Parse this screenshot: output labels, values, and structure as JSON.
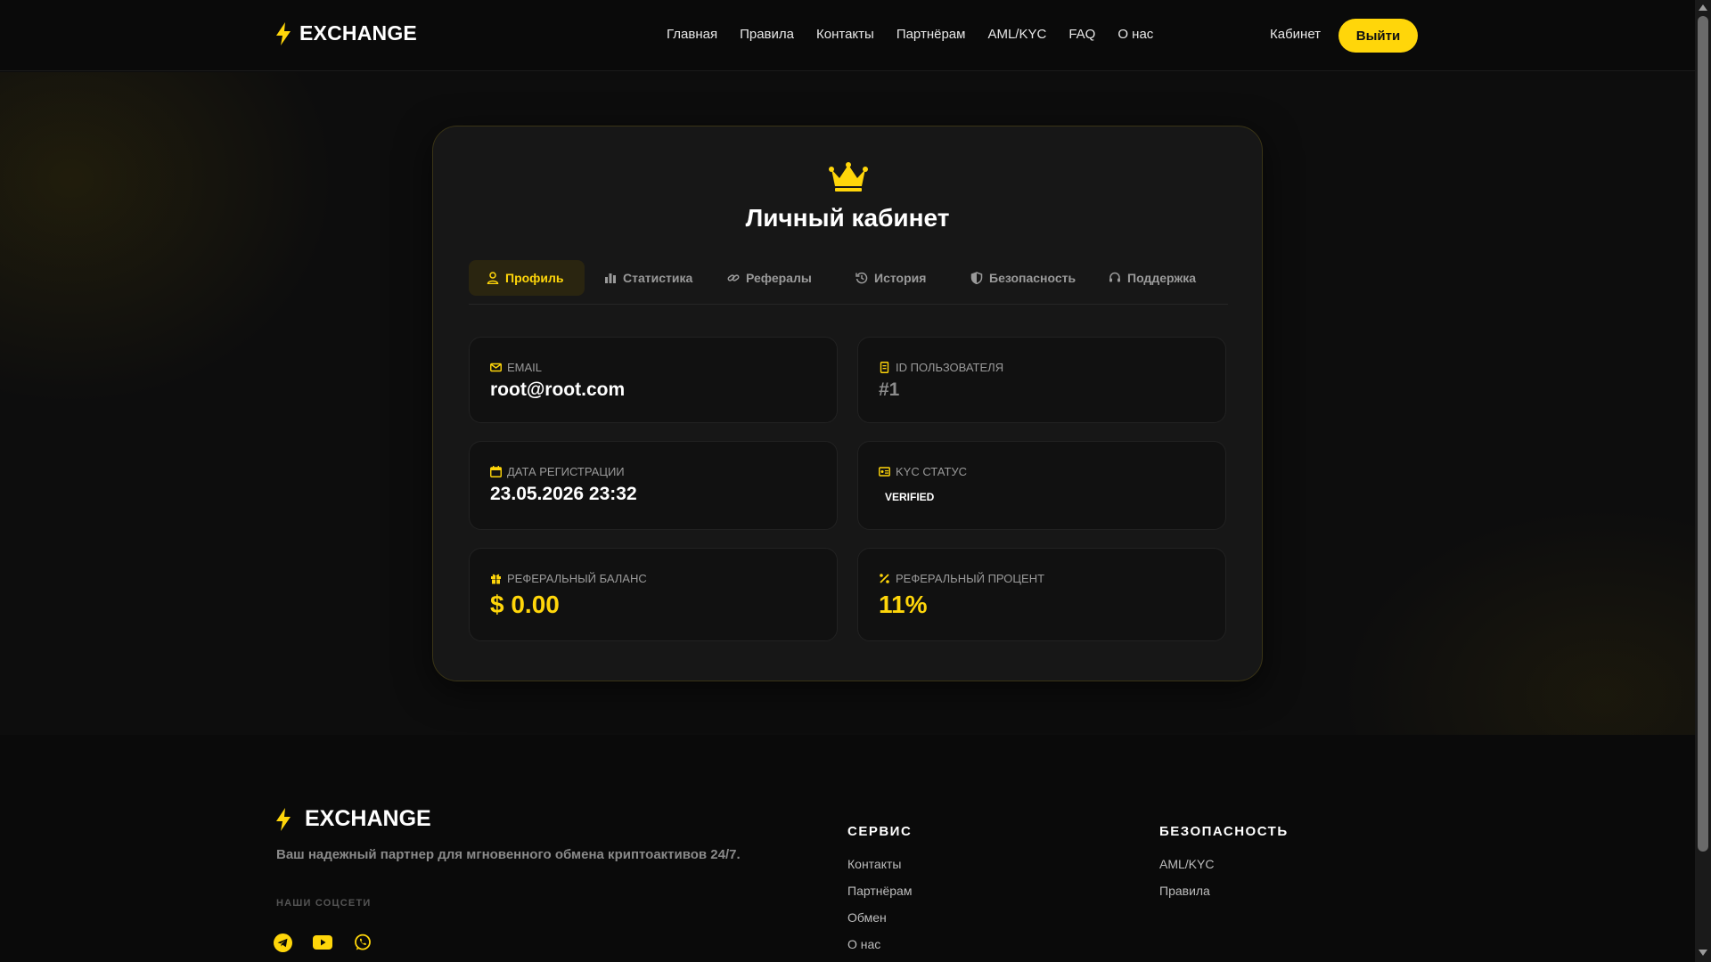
{
  "header": {
    "brand": "EXCHANGE",
    "nav": [
      "Главная",
      "Правила",
      "Контакты",
      "Партнёрам",
      "AML/KYC",
      "FAQ",
      "О нас"
    ],
    "cabinet_link": "Кабинет",
    "logout_label": "Выйти"
  },
  "card": {
    "title": "Личный кабинет",
    "tabs": [
      {
        "label": "Профиль",
        "icon": "user-icon",
        "active": true
      },
      {
        "label": "Статистика",
        "icon": "bar-chart-icon"
      },
      {
        "label": "Рефералы",
        "icon": "link-icon"
      },
      {
        "label": "История",
        "icon": "history-icon"
      },
      {
        "label": "Безопасность",
        "icon": "shield-icon"
      },
      {
        "label": "Поддержка",
        "icon": "headset-icon"
      }
    ],
    "fields": {
      "email": {
        "label": "EMAIL",
        "value": "root@root.com",
        "icon": "envelope-icon"
      },
      "user_id": {
        "label": "ID ПОЛЬЗОВАТЕЛЯ",
        "value": "#1",
        "icon": "id-card-icon"
      },
      "reg_date": {
        "label": "ДАТА РЕГИСТРАЦИИ",
        "value": "23.05.2026 23:32",
        "icon": "calendar-icon"
      },
      "kyc": {
        "label": "KYC СТАТУС",
        "value": "VERIFIED",
        "icon": "id-badge-icon"
      },
      "ref_balance": {
        "label": "РЕФЕРАЛЬНЫЙ БАЛАНС",
        "value": "$ 0.00",
        "icon": "gift-icon"
      },
      "ref_percent": {
        "label": "РЕФЕРАЛЬНЫЙ ПРОЦЕНТ",
        "value": "11%",
        "icon": "percent-icon"
      }
    }
  },
  "footer": {
    "brand": "EXCHANGE",
    "tagline": "Ваш надежный партнер для мгновенного обмена криптоактивов 24/7.",
    "social_title": "НАШИ СОЦСЕТИ",
    "socials": [
      "telegram-icon",
      "youtube-icon",
      "whatsapp-icon"
    ],
    "service": {
      "title": "СЕРВИС",
      "links": [
        "Контакты",
        "Партнёрам",
        "Обмен",
        "О нас"
      ]
    },
    "security": {
      "title": "БЕЗОПАСНОСТЬ",
      "links": [
        "AML/KYC",
        "Правила"
      ]
    }
  },
  "colors": {
    "accent": "#ffd60a",
    "background": "#0b0b0b",
    "card": "#171717"
  }
}
